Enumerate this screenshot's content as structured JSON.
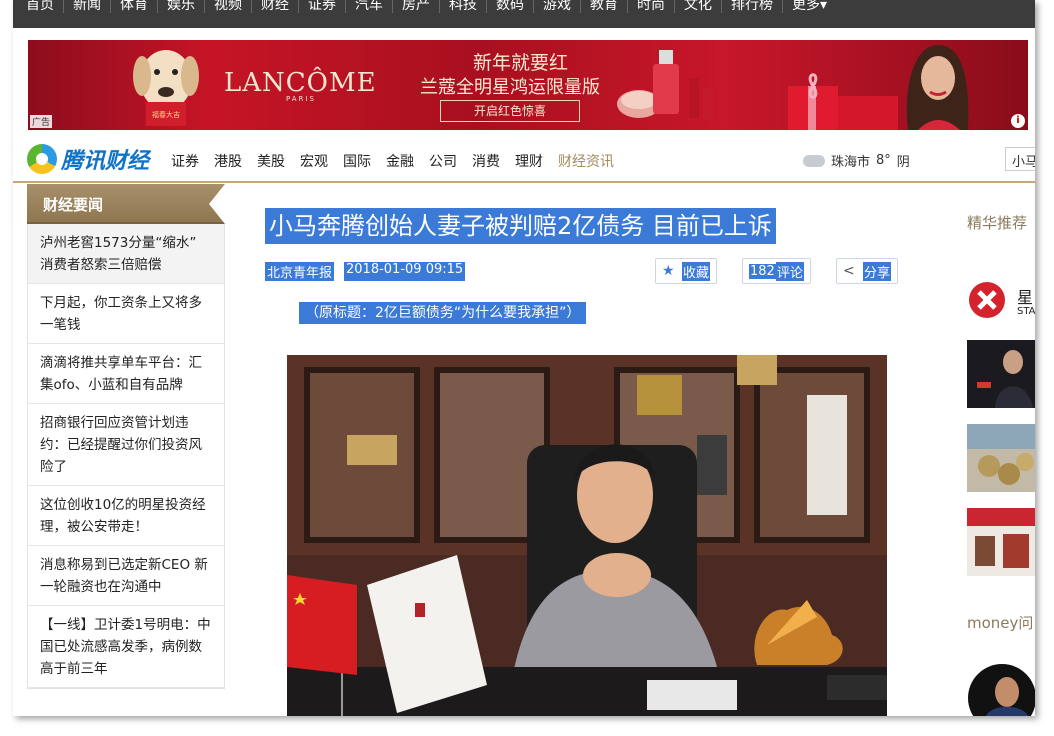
{
  "top_nav": {
    "items": [
      "首页",
      "新闻",
      "体育",
      "娱乐",
      "视频",
      "财经",
      "证券",
      "汽车",
      "房产",
      "科技",
      "数码",
      "游戏",
      "教育",
      "时尚",
      "文化",
      "排行榜",
      "更多▾"
    ]
  },
  "ad": {
    "brand": "LANCÔME",
    "brand_sub": "PARIS",
    "line1": "新年就要红",
    "line2": "兰蔻全明星鸿运限量版",
    "cta": "开启红色惊喜",
    "tag": "广告",
    "dog_card": "福春大吉"
  },
  "channel_bar": {
    "logo_text": "腾讯财经",
    "channels": [
      "证券",
      "港股",
      "美股",
      "宏观",
      "国际",
      "金融",
      "公司",
      "消费",
      "理财",
      "财经资讯"
    ],
    "weather": {
      "city": "珠海市",
      "temp": "8°",
      "condition": "阴"
    },
    "search_value": "小马"
  },
  "left_news": {
    "header": "财经要闻",
    "items": [
      "泸州老窖1573分量“缩水” 消费者怒索三倍赔偿",
      "下月起，你工资条上又将多一笔钱",
      "滴滴将推共享单车平台：汇集ofo、小蓝和自有品牌",
      "招商银行回应资管计划违约：已经提醒过你们投资风险了",
      "这位创收10亿的明星投资经理，被公安带走！",
      "消息称易到已选定新CEO 新一轮融资也在沟通中",
      "【一线】卫计委1号明电：中国已处流感高发季，病例数高于前三年"
    ]
  },
  "article": {
    "title": "小马奔腾创始人妻子被判赔2亿债务 目前已上诉",
    "source": "北京青年报",
    "datetime": "2018-01-09 09:15",
    "collect_label": "收藏",
    "comment_count": "182",
    "comment_label": "评论",
    "share_label": "分享",
    "subtitle": "（原标题：2亿巨额债务“为什么要我承担”）"
  },
  "right_col": {
    "heading": "精华推荐",
    "logo_text": "星",
    "logo_sub": "STA",
    "heading2": "money问"
  },
  "colors": {
    "accent": "#3b7ad7",
    "brand_blue": "#0f74c8",
    "gold": "#a68a5b",
    "ad_red": "#c61426"
  }
}
